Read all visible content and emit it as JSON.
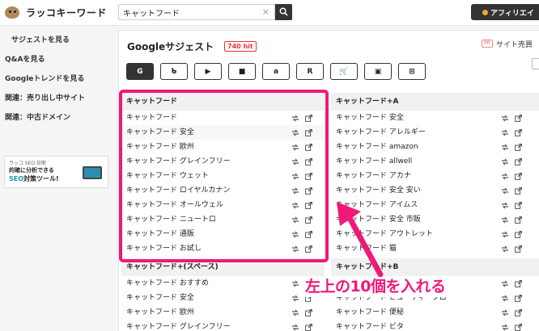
{
  "header": {
    "logo_text": "ラッコキーワード",
    "search_value": "キャットフード",
    "clear_glyph": "×",
    "affiliate_label": "アフィリエイ"
  },
  "sidebar": {
    "items": [
      {
        "label": "サジェストを見る"
      },
      {
        "label": "Q&Aを見る"
      },
      {
        "label": "Googleトレンドを見る"
      },
      {
        "label": "関連：売り出し中サイト"
      },
      {
        "label": "関連：中古ドメイン"
      }
    ],
    "banner": {
      "line1": "ラッコ SEO 診断",
      "line2": "的確に分析できる",
      "line3_accent": "SEO",
      "line3_rest": "対策ツール!"
    }
  },
  "panel": {
    "title": "Googleサジェスト",
    "hit_badge": "740 hit",
    "pr_badge": "PR",
    "pr_text": "サイト売買",
    "engine_tabs": [
      {
        "icon": "google-icon",
        "glyph": "G",
        "active": true
      },
      {
        "icon": "bing-icon",
        "glyph": "ᑲ",
        "active": false
      },
      {
        "icon": "youtube-icon",
        "glyph": "▶",
        "active": false
      },
      {
        "icon": "video-icon",
        "glyph": "■",
        "active": false
      },
      {
        "icon": "amazon-icon",
        "glyph": "a",
        "active": false
      },
      {
        "icon": "rakuten-icon",
        "glyph": "R",
        "active": false
      },
      {
        "icon": "shopping-cart-icon",
        "glyph": "🛒",
        "active": false
      },
      {
        "icon": "image-icon",
        "glyph": "▣",
        "active": false
      },
      {
        "icon": "grid-icon",
        "glyph": "⊞",
        "active": false
      }
    ]
  },
  "columns": [
    {
      "header": "キャットフード",
      "rows": [
        "キャットフード",
        "キャットフード 安全",
        "キャットフード 欧州",
        "キャットフード グレインフリー",
        "キャットフード ウェット",
        "キャットフード ロイヤルカナン",
        "キャットフード オールウェル",
        "キャットフード ニュートロ",
        "キャットフード 通販",
        "キャットフード お試し"
      ]
    },
    {
      "header": "キャットフード+A",
      "rows": [
        "キャットフード 安全",
        "キャットフード アレルギー",
        "キャットフード amazon",
        "キャットフード allwell",
        "キャットフード アカナ",
        "キャットフード 安全 安い",
        "キャットフード アイムス",
        "キャットフード 安全 市販",
        "キャットフード アウトレット",
        "キャットフード 猫"
      ]
    },
    {
      "header": "キャットフード+(スペース)",
      "rows": [
        "キャットフード おすすめ",
        "キャットフード 安全",
        "キャットフード 欧州",
        "キャットフード グレインフリー"
      ]
    },
    {
      "header": "キャットフード+B",
      "rows": [
        "キャットフード ビュッフェ",
        "キャットフード ビューティープロ",
        "キャットフード 便秘",
        "キャットフード ビタ"
      ]
    }
  ],
  "annotation": {
    "label": "左上の10個を入れる"
  },
  "colors": {
    "accent": "#f0197a",
    "hit_badge": "#e33333",
    "dark": "#333333"
  }
}
